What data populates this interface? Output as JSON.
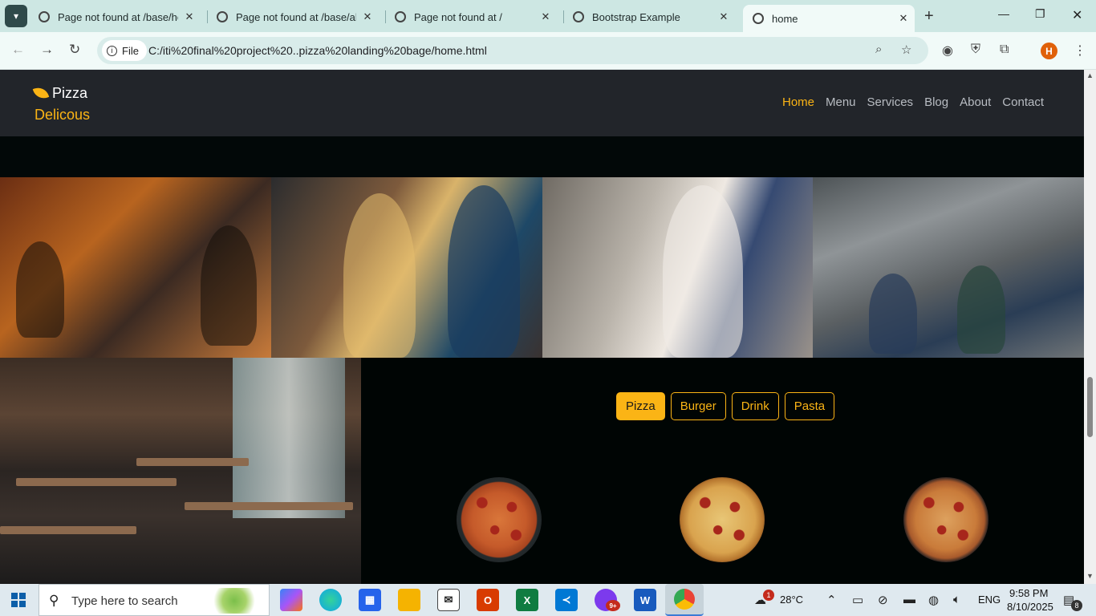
{
  "browser": {
    "tabs": [
      {
        "title": "Page not found at /base/hor"
      },
      {
        "title": "Page not found at /base/abo"
      },
      {
        "title": "Page not found at /"
      },
      {
        "title": "Bootstrap Example"
      },
      {
        "title": "home"
      }
    ],
    "active_tab_index": 4,
    "site_chip": "File",
    "url": "C:/iti%20final%20project%20..pizza%20landing%20bage/home.html",
    "profile_initial": "H",
    "accent_color": "#cde7e3"
  },
  "site": {
    "brand": {
      "word1": "Pizza",
      "word2": "Delicous",
      "color": "#fbb415"
    },
    "nav": [
      {
        "label": "Home",
        "active": true
      },
      {
        "label": "Menu",
        "active": false
      },
      {
        "label": "Services",
        "active": false
      },
      {
        "label": "Blog",
        "active": false
      },
      {
        "label": "About",
        "active": false
      },
      {
        "label": "Contact",
        "active": false
      }
    ],
    "gallery": [
      {
        "description": "group-dining-photo"
      },
      {
        "description": "couple-laughing-photo"
      },
      {
        "description": "barista-payment-photo"
      },
      {
        "description": "cafe-kitchen-overhead-photo"
      }
    ],
    "menu_filters": [
      {
        "label": "Pizza",
        "active": true
      },
      {
        "label": "Burger",
        "active": false
      },
      {
        "label": "Drink",
        "active": false
      },
      {
        "label": "Pasta",
        "active": false
      }
    ],
    "menu_items": [
      {
        "image": "sliced-pizza-image"
      },
      {
        "image": "pepperoni-pizza-image"
      },
      {
        "image": "supreme-pizza-image"
      }
    ]
  },
  "taskbar": {
    "search_placeholder": "Type here to search",
    "temperature": "28°C",
    "weather_badge": "1",
    "language": "ENG",
    "time": "9:58 PM",
    "date": "8/10/2025",
    "notification_count": "8",
    "copilot_badge": "9+"
  }
}
